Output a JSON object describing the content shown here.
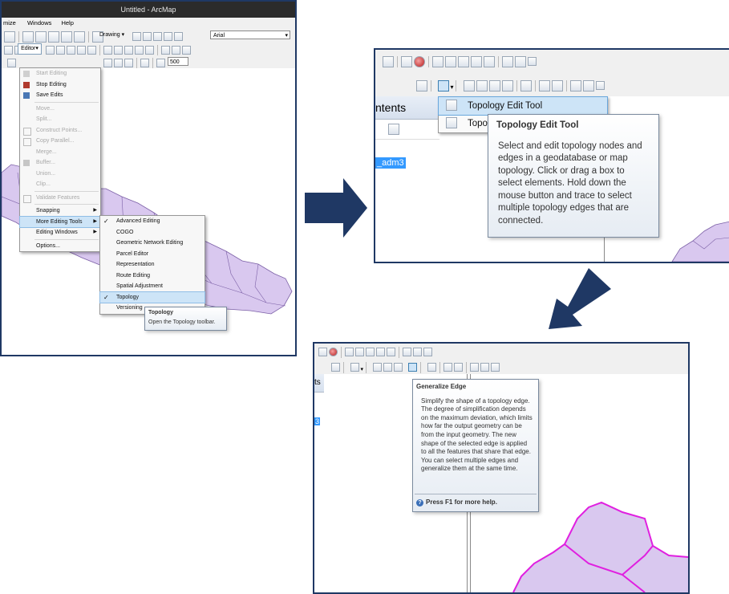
{
  "panel1": {
    "title": "Untitled - ArcMap",
    "menubar": [
      "mize",
      "Windows",
      "Help"
    ],
    "drawing_label": "Drawing",
    "font_name": "Arial",
    "editor_label": "Editor",
    "scale_value": "500",
    "editor_menu": [
      {
        "label": "Start Editing",
        "disabled": true
      },
      {
        "label": "Stop Editing",
        "disabled": false
      },
      {
        "label": "Save Edits",
        "disabled": false
      },
      {
        "label": "Move...",
        "disabled": true
      },
      {
        "label": "Split...",
        "disabled": true
      },
      {
        "label": "Construct Points...",
        "disabled": true
      },
      {
        "label": "Copy Parallel...",
        "disabled": true
      },
      {
        "label": "Merge...",
        "disabled": true
      },
      {
        "label": "Buffer...",
        "disabled": true
      },
      {
        "label": "Union...",
        "disabled": true
      },
      {
        "label": "Clip...",
        "disabled": true
      },
      {
        "label": "Validate Features",
        "disabled": true
      },
      {
        "label": "Snapping",
        "disabled": false
      },
      {
        "label": "More Editing Tools",
        "disabled": false
      },
      {
        "label": "Editing Windows",
        "disabled": false
      },
      {
        "label": "Options...",
        "disabled": false
      }
    ],
    "submenu": [
      "Advanced Editing",
      "COGO",
      "Geometric Network Editing",
      "Parcel Editor",
      "Representation",
      "Route Editing",
      "Spatial Adjustment",
      "Topology",
      "Versioning"
    ],
    "tooltip_title": "Topology",
    "tooltip_text": "Open the Topology toolbar."
  },
  "panel2": {
    "toc_title": "ntents",
    "layer_label": "_adm3",
    "dropdown_items": [
      "Topology Edit Tool",
      "Topo"
    ],
    "tooltip_title": "Topology Edit Tool",
    "tooltip_body": "Select and edit topology nodes and edges in a geodatabase or map topology. Click or drag a box to select elements. Hold down the mouse button and trace to select multiple topology edges that are connected."
  },
  "panel3": {
    "toc_title": "ts",
    "layer_label": "3",
    "tooltip_title": "Generalize Edge",
    "tooltip_body": "Simplify the shape of a topology edge. The degree of simplification depends on the maximum deviation, which limits how far the output geometry can be from the input geometry. The new shape of the selected edge is applied to all the features that share that edge. You can select multiple edges and generalize them at the same time.",
    "help_text": "Press F1 for more help."
  },
  "colors": {
    "frame": "#1f3864",
    "arrow": "#1f3864",
    "highlight": "#cde4f7",
    "polygon_fill": "#d9c8ef",
    "polygon_stroke": "#7b5fa6",
    "edge_highlight": "#e020e0"
  }
}
